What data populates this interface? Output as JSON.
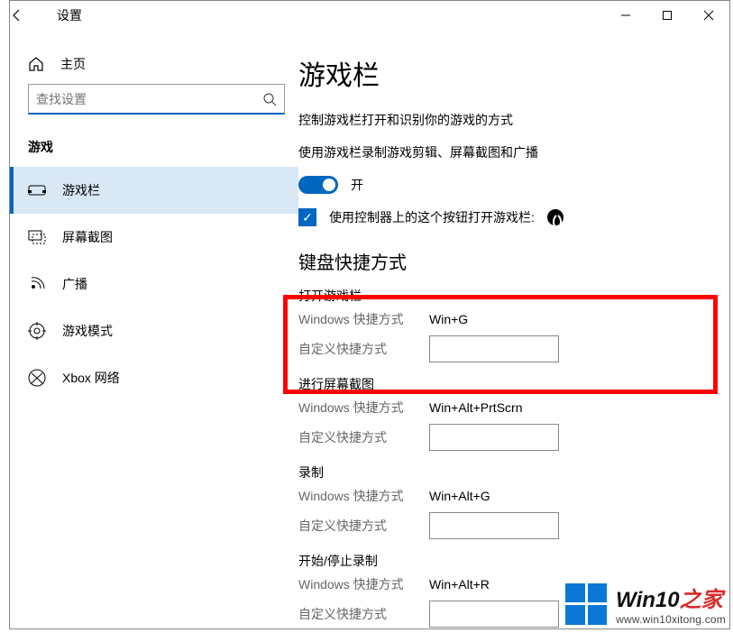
{
  "titlebar": {
    "title": "设置"
  },
  "sidebar": {
    "home_label": "主页",
    "search_placeholder": "查找设置",
    "category_label": "游戏",
    "items": [
      {
        "label": "游戏栏"
      },
      {
        "label": "屏幕截图"
      },
      {
        "label": "广播"
      },
      {
        "label": "游戏模式"
      },
      {
        "label": "Xbox 网络"
      }
    ]
  },
  "main": {
    "heading": "游戏栏",
    "desc": "控制游戏栏打开和识别你的游戏的方式",
    "toggle_caption": "使用游戏栏录制游戏剪辑、屏幕截图和广播",
    "toggle_state_label": "开",
    "checkbox_label": "使用控制器上的这个按钮打开游戏栏:",
    "shortcuts_heading": "键盘快捷方式",
    "win_shortcut_label": "Windows 快捷方式",
    "custom_shortcut_label": "自定义快捷方式",
    "groups": [
      {
        "title": "打开游戏栏",
        "win_value": "Win+G",
        "custom_value": ""
      },
      {
        "title": "进行屏幕截图",
        "win_value": "Win+Alt+PrtScrn",
        "custom_value": ""
      },
      {
        "title": "录制",
        "win_value": "Win+Alt+G",
        "custom_value": ""
      },
      {
        "title": "开始/停止录制",
        "win_value": "Win+Alt+R",
        "custom_value": ""
      }
    ]
  },
  "watermark": {
    "brand_a": "Win10",
    "brand_b": "之家",
    "url": "www.win10xitong.com"
  }
}
